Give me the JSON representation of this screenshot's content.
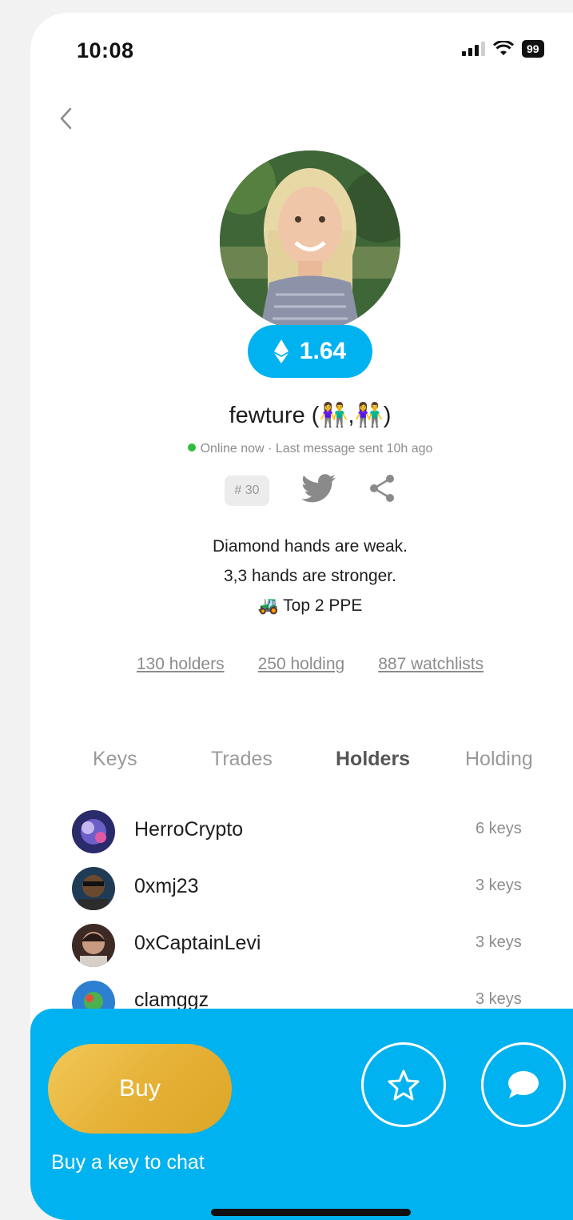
{
  "status_bar": {
    "time": "10:08",
    "battery": "99"
  },
  "profile": {
    "price": "1.64",
    "username": "fewture (👫,👫)",
    "online_status": "Online now",
    "last_message": "· Last message sent 10h ago",
    "rank": "# 30",
    "bio_line1": "Diamond hands are weak.",
    "bio_line2": "3,3 hands are stronger.",
    "bio_line3": "🚜 Top 2 PPE"
  },
  "stats": {
    "holders": "130 holders",
    "holding": "250 holding",
    "watchlists": "887 watchlists"
  },
  "tabs": [
    "Keys",
    "Trades",
    "Holders",
    "Holding"
  ],
  "active_tab": "Holders",
  "holders": [
    {
      "name": "HerroCrypto",
      "keys": "6 keys"
    },
    {
      "name": "0xmj23",
      "keys": "3 keys"
    },
    {
      "name": "0xCaptainLevi",
      "keys": "3 keys"
    },
    {
      "name": "clamggz",
      "keys": "3 keys"
    }
  ],
  "bottom": {
    "buy_label": "Buy",
    "buy_hint": "Buy a key to chat"
  },
  "colors": {
    "accent": "#00b2ef",
    "buy_gold": "#e5b035",
    "online": "#2ebd3b"
  }
}
